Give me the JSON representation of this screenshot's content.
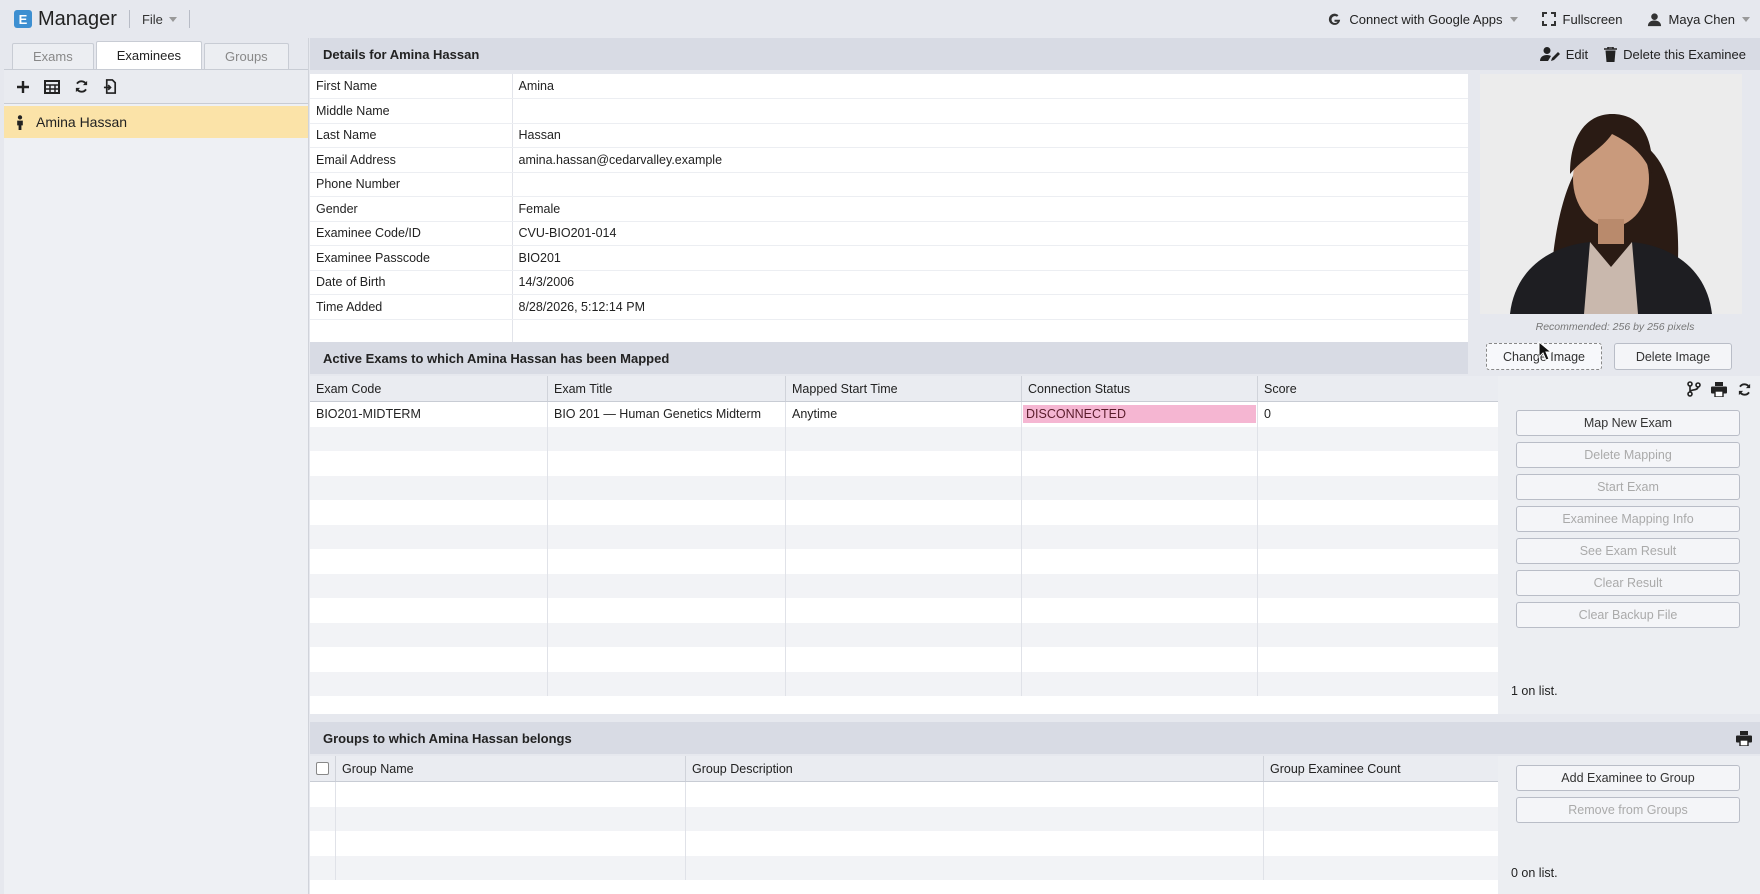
{
  "app": {
    "logo_letter": "E",
    "title": "Manager",
    "file_menu": "File"
  },
  "topbar": {
    "google": "Connect with Google Apps",
    "fullscreen": "Fullscreen",
    "user": "Maya Chen"
  },
  "sidebar": {
    "tabs": [
      "Exams",
      "Examinees",
      "Groups"
    ],
    "active_tab": "Examinees",
    "items": [
      {
        "label": "Amina Hassan"
      }
    ]
  },
  "details": {
    "title": "Details for Amina Hassan",
    "edit_label": "Edit",
    "delete_label": "Delete this Examinee",
    "rows": [
      {
        "label": "First Name",
        "value": "Amina"
      },
      {
        "label": "Middle Name",
        "value": ""
      },
      {
        "label": "Last Name",
        "value": "Hassan"
      },
      {
        "label": "Email Address",
        "value": "amina.hassan@cedarvalley.example"
      },
      {
        "label": "Phone Number",
        "value": ""
      },
      {
        "label": "Gender",
        "value": "Female"
      },
      {
        "label": "Examinee Code/ID",
        "value": "CVU-BIO201-014"
      },
      {
        "label": "Examinee Passcode",
        "value": "BIO201"
      },
      {
        "label": "Date of Birth",
        "value": "14/3/2006"
      },
      {
        "label": "Time Added",
        "value": "8/28/2026, 5:12:14 PM"
      }
    ],
    "photo_note": "Recommended: 256 by 256 pixels",
    "change_image": "Change Image",
    "delete_image": "Delete Image"
  },
  "exams": {
    "title": "Active Exams to which Amina Hassan has been Mapped",
    "columns": [
      "Exam Code",
      "Exam Title",
      "Mapped Start Time",
      "Connection Status",
      "Score"
    ],
    "rows": [
      {
        "code": "BIO201-MIDTERM",
        "title": "BIO 201 — Human Genetics Midterm",
        "start": "Anytime",
        "status": "DISCONNECTED",
        "score": "0"
      }
    ],
    "buttons": [
      "Map New Exam",
      "Delete Mapping",
      "Start Exam",
      "Examinee Mapping Info",
      "See Exam Result",
      "Clear Result",
      "Clear Backup File"
    ],
    "count_text": "1 on list."
  },
  "groups": {
    "title": "Groups to which Amina Hassan belongs",
    "columns": [
      "Group Name",
      "Group Description",
      "Group Examinee Count"
    ],
    "buttons": [
      "Add Examinee to Group",
      "Remove from Groups"
    ],
    "count_text": "0 on list."
  },
  "colors": {
    "selected_row": "#fbe3a8",
    "disconnected": "#f5b6d2",
    "logo": "#3d8fd1"
  }
}
